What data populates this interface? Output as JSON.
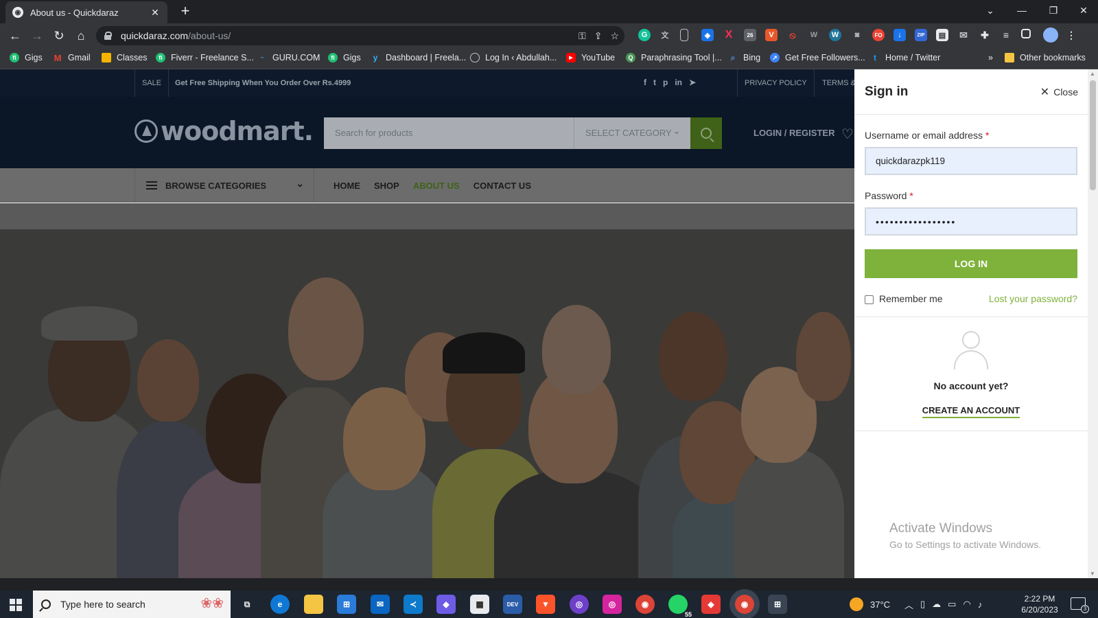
{
  "browser": {
    "tab_title": "About us - Quickdaraz",
    "url_host": "quickdaraz.com",
    "url_path": "/about-us/",
    "bookmarks": [
      {
        "label": "Gigs",
        "color": "#1dbf73",
        "glyph": "fi"
      },
      {
        "label": "Gmail",
        "color": "#ea4335",
        "glyph": "M"
      },
      {
        "label": "Classes",
        "color": "#f4b400",
        "glyph": "▣"
      },
      {
        "label": "Fiverr - Freelance S...",
        "color": "#1dbf73",
        "glyph": "fi"
      },
      {
        "label": "GURU.COM",
        "color": "#4a90d9",
        "glyph": "~"
      },
      {
        "label": "Gigs",
        "color": "#1dbf73",
        "glyph": "fi"
      },
      {
        "label": "Dashboard | Freela...",
        "color": "#29b2fe",
        "glyph": "y"
      },
      {
        "label": "Log In ‹ Abdullah...",
        "color": "#9aa0a6",
        "glyph": "◎"
      },
      {
        "label": "YouTube",
        "color": "#ff0000",
        "glyph": "▶"
      },
      {
        "label": "Paraphrasing Tool |...",
        "color": "#499557",
        "glyph": "Q"
      },
      {
        "label": "Bing",
        "color": "#4a90d9",
        "glyph": "⌕"
      },
      {
        "label": "Get Free Followers...",
        "color": "#3b82f6",
        "glyph": "↗"
      },
      {
        "label": "Home / Twitter",
        "color": "#1d9bf0",
        "glyph": "t"
      }
    ],
    "other_bookmarks": "Other bookmarks",
    "extension_badge": "26"
  },
  "site": {
    "topbar": {
      "sale": "SALE",
      "shipping": "Get Free Shipping When You Order Over Rs.4999",
      "privacy": "PRIVACY POLICY",
      "terms": "TERMS &"
    },
    "logo": "woodmart.",
    "search_placeholder": "Search for products",
    "select_category": "SELECT CATEGORY",
    "login_register": "LOGIN / REGISTER",
    "browse_categories": "BROWSE CATEGORIES",
    "menu": [
      "HOME",
      "SHOP",
      "ABOUT US",
      "CONTACT US"
    ]
  },
  "signin": {
    "title": "Sign in",
    "close": "Close",
    "username_label": "Username or email address",
    "username_value": "quickdarazpk119",
    "password_label": "Password",
    "password_value": "•••••••••••••••••",
    "required_mark": "*",
    "login_button": "LOG IN",
    "remember_me": "Remember me",
    "lost_password": "Lost your password?",
    "no_account": "No account yet?",
    "create_account": "CREATE AN ACCOUNT"
  },
  "watermark": {
    "line1": "Activate Windows",
    "line2": "Go to Settings to activate Windows."
  },
  "taskbar": {
    "search_placeholder": "Type here to search",
    "temperature": "37°C",
    "time": "2:22 PM",
    "date": "6/20/2023",
    "whatsapp_badge": "55",
    "notification_count": "3"
  },
  "colors": {
    "accent_green": "#7eb23a",
    "required_red": "#e01020"
  }
}
